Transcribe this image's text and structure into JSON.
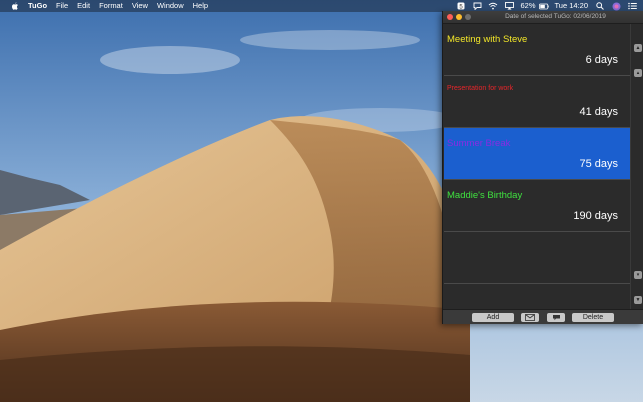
{
  "menubar": {
    "app_name": "TuGo",
    "menus": [
      "File",
      "Edit",
      "Format",
      "View",
      "Window",
      "Help"
    ],
    "battery_percent": "62%",
    "clock": "Tue 14:20"
  },
  "window": {
    "title": "Date of selected TuGo: 02/06/2019",
    "items": [
      {
        "title": "Meeting with Steve",
        "days": "6 days",
        "color": "#f2e629"
      },
      {
        "title": "Presentation for work",
        "days": "41 days",
        "color": "#e8252a"
      },
      {
        "title": "Summer Break",
        "days": "75 days",
        "color": "#8a2be2"
      },
      {
        "title": "Maddie's Birthday",
        "days": "190 days",
        "color": "#3fe23f"
      }
    ],
    "selected_index": 2,
    "buttons": {
      "add": "Add",
      "delete": "Delete"
    }
  },
  "colors": {
    "selection": "#1b5fcf",
    "window_bg": "#2b2b2b"
  }
}
